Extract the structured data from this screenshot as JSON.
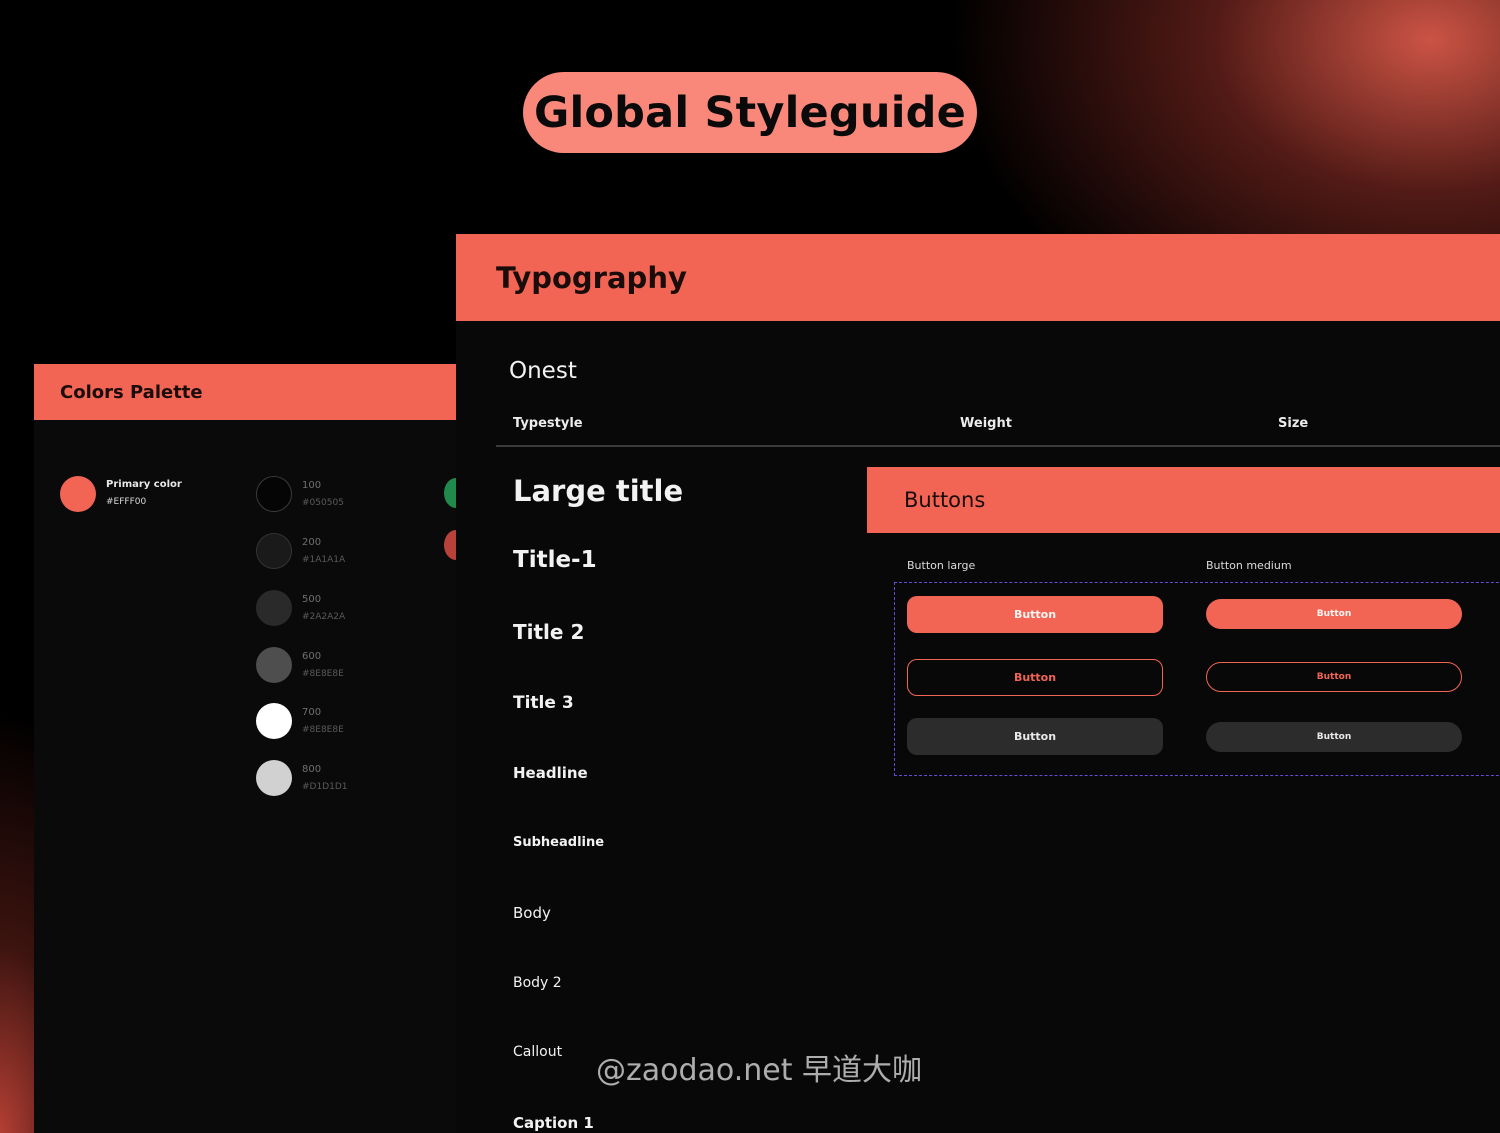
{
  "title": "Global Styleguide",
  "colors": {
    "header": "Colors Palette",
    "primary": {
      "label": "Primary color",
      "hex": "#EFFF00",
      "swatch": "#f26555"
    },
    "shades": [
      {
        "num": "100",
        "hex": "#050505",
        "swatch": "#050505"
      },
      {
        "num": "200",
        "hex": "#1A1A1A",
        "swatch": "#1a1a1a"
      },
      {
        "num": "500",
        "hex": "#2A2A2A",
        "swatch": "#2a2a2a"
      },
      {
        "num": "600",
        "hex": "#8E8E8E",
        "swatch": "#4e4e4e"
      },
      {
        "num": "700",
        "hex": "#8E8E8E",
        "swatch": "#ffffff"
      },
      {
        "num": "800",
        "hex": "#D1D1D1",
        "swatch": "#d1d1d1"
      }
    ],
    "edge_swatches": [
      "#1f8a4c",
      "#b8413a"
    ]
  },
  "typography": {
    "header": "Typography",
    "font_name": "Onest",
    "columns": [
      "Typestyle",
      "Weight",
      "Size"
    ],
    "styles": [
      "Large title",
      "Title-1",
      "Title 2",
      "Title 3",
      "Headline",
      "Subheadline",
      "Body",
      "Body 2",
      "Callout",
      "Caption 1"
    ]
  },
  "buttons": {
    "header": "Buttons",
    "large_label": "Button large",
    "medium_label": "Button medium",
    "button_text": "Button"
  },
  "watermark": "@zaodao.net 早道大咖",
  "accent_color": "#f26555"
}
